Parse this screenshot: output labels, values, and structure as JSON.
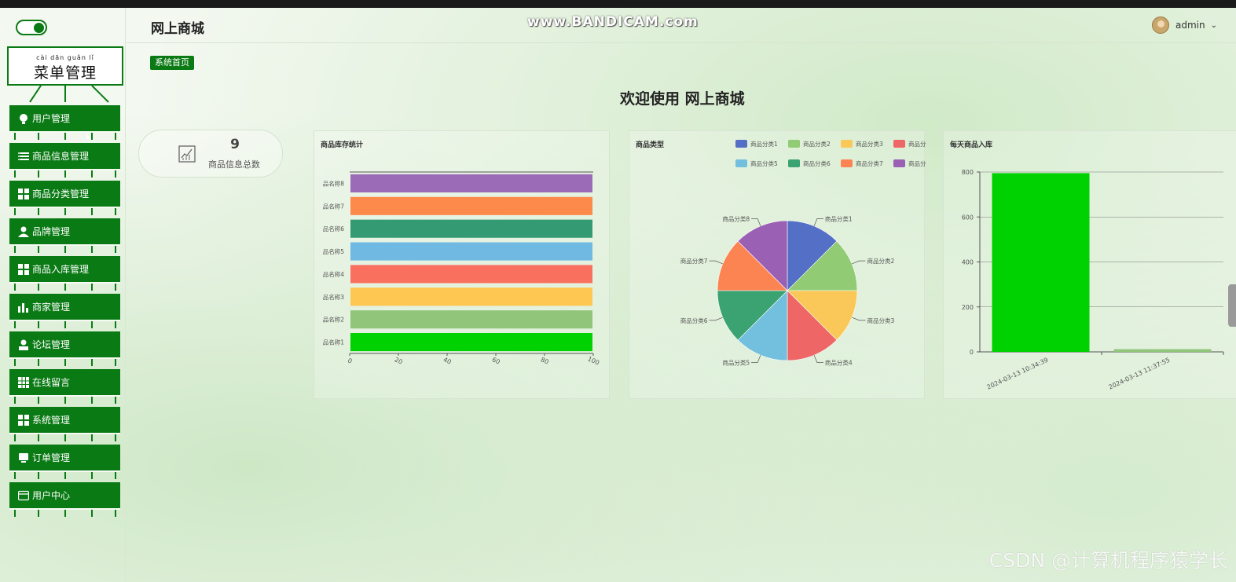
{
  "watermarks": {
    "top": "www.BANDICAM.com",
    "bottom": "CSDN @计算机程序猿学长"
  },
  "sidebar": {
    "sign_pinyin": "cài dān guǎn lǐ",
    "sign_title": "菜单管理",
    "items": [
      {
        "label": "用户管理",
        "icon": "lightbulb-icon"
      },
      {
        "label": "商品信息管理",
        "icon": "list-icon"
      },
      {
        "label": "商品分类管理",
        "icon": "grid-icon"
      },
      {
        "label": "品牌管理",
        "icon": "user-icon"
      },
      {
        "label": "商品入库管理",
        "icon": "grid-icon"
      },
      {
        "label": "商家管理",
        "icon": "bar-chart-icon"
      },
      {
        "label": "论坛管理",
        "icon": "person-icon"
      },
      {
        "label": "在线留言",
        "icon": "table-icon"
      },
      {
        "label": "系统管理",
        "icon": "grid-icon"
      },
      {
        "label": "订单管理",
        "icon": "monitor-icon"
      },
      {
        "label": "用户中心",
        "icon": "card-icon"
      }
    ]
  },
  "header": {
    "title": "网上商城",
    "username": "admin",
    "caret": "⌄"
  },
  "breadcrumb": "系统首页",
  "welcome": "欢迎使用 网上商城",
  "stat": {
    "value": "9",
    "label": "商品信息总数"
  },
  "colors": {
    "primary": "#0a7a14",
    "bar_green": "#00d100"
  },
  "charts": [
    {
      "title": "商品库存统计",
      "chart_data": {
        "type": "bar",
        "orientation": "horizontal",
        "categories": [
          "品名称1",
          "品名称2",
          "品名称3",
          "品名称4",
          "品名称5",
          "品名称6",
          "品名称7",
          "品名称8"
        ],
        "values": [
          100,
          100,
          100,
          100,
          100,
          100,
          100,
          100
        ],
        "colors": [
          "#00d100",
          "#91c57a",
          "#fdc752",
          "#f9705f",
          "#6fb9e2",
          "#339a73",
          "#fd894a",
          "#9c6bb8"
        ],
        "xlim": [
          0,
          100
        ],
        "xticks": [
          "0",
          "20",
          "40",
          "60",
          "80",
          "100"
        ]
      }
    },
    {
      "title": "商品类型",
      "chart_data": {
        "type": "pie",
        "labels": [
          "商品分类1",
          "商品分类2",
          "商品分类3",
          "商品分类4",
          "商品分类5",
          "商品分类6",
          "商品分类7",
          "商品分类8"
        ],
        "values": [
          1,
          1,
          1,
          1,
          1,
          1,
          1,
          1
        ],
        "colors": [
          "#5470c6",
          "#91cc75",
          "#fac858",
          "#ee6666",
          "#73c0de",
          "#3ba272",
          "#fc8452",
          "#9a60b4"
        ],
        "legend": "top"
      }
    },
    {
      "title": "每天商品入库",
      "chart_data": {
        "type": "bar",
        "categories": [
          "2024-03-13 10:34:39",
          "2024-03-13 11:37:55"
        ],
        "values": [
          795,
          12
        ],
        "colors": [
          "#00d100",
          "#91c57a"
        ],
        "ylim": [
          0,
          800
        ],
        "yticks": [
          "0",
          "200",
          "400",
          "600",
          "800"
        ],
        "grid": true
      }
    }
  ]
}
